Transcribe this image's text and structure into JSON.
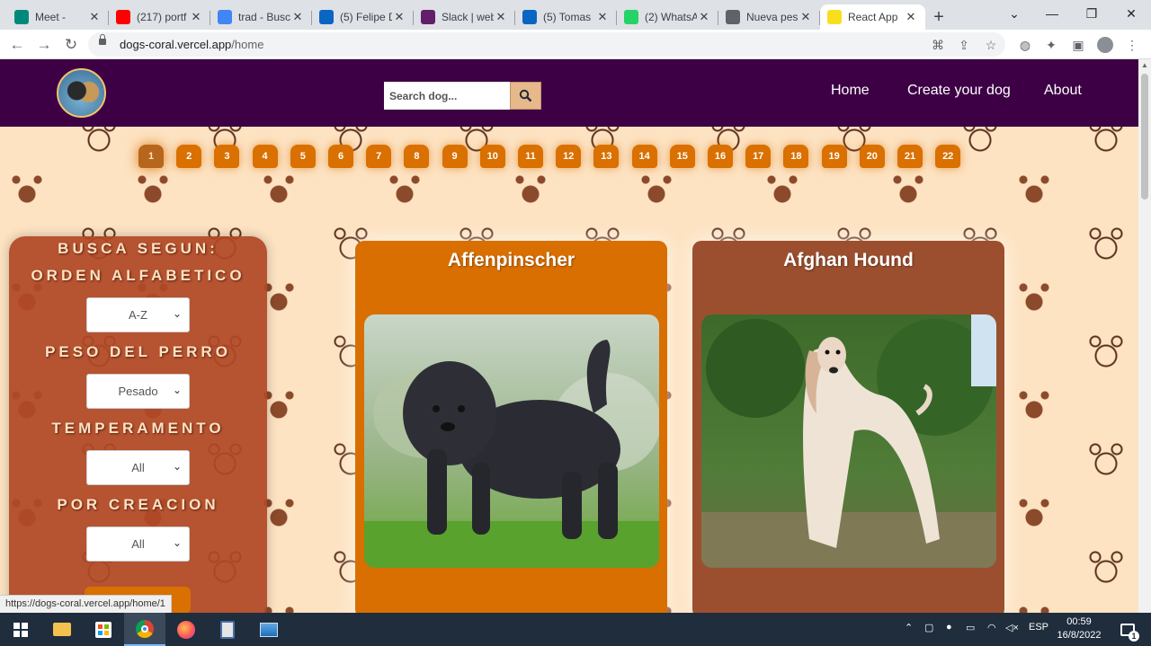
{
  "browser": {
    "tabs": [
      {
        "title": "Meet -",
        "favicon": "meet-icon",
        "color": "#00897b"
      },
      {
        "title": "(217) portf",
        "favicon": "youtube-icon",
        "color": "#ff0000"
      },
      {
        "title": "trad - Busc",
        "favicon": "google-icon",
        "color": "#4285f4"
      },
      {
        "title": "(5) Felipe D",
        "favicon": "linkedin-icon",
        "color": "#0a66c2"
      },
      {
        "title": "Slack | web",
        "favicon": "slack-icon",
        "color": "#611f69"
      },
      {
        "title": "(5) Tomas",
        "favicon": "linkedin-icon",
        "color": "#0a66c2"
      },
      {
        "title": "(2) WhatsA",
        "favicon": "whatsapp-icon",
        "color": "#25d366"
      },
      {
        "title": "Nueva pes",
        "favicon": "chrome-icon",
        "color": "#5f6368"
      },
      {
        "title": "React App",
        "favicon": "react-app-icon",
        "color": "#f7df1e",
        "active": true
      }
    ],
    "url_host": "dogs-coral.vercel.app",
    "url_path": "/home",
    "status_url": "https://dogs-coral.vercel.app/home/1"
  },
  "header": {
    "search_placeholder": "Search dog...",
    "nav": [
      "Home",
      "Create your dog",
      "About"
    ]
  },
  "pagination": {
    "pages": [
      "1",
      "2",
      "3",
      "4",
      "5",
      "6",
      "7",
      "8",
      "9",
      "10",
      "11",
      "12",
      "13",
      "14",
      "15",
      "16",
      "17",
      "18",
      "19",
      "20",
      "21",
      "22"
    ],
    "current": "1"
  },
  "filters": {
    "title_line1": "BUSCA SEGUN:",
    "title_line2": "ORDEN ALFABETICO",
    "order_value": "A-Z",
    "weight_label": "PESO DEL PERRO",
    "weight_value": "Pesado",
    "temperament_label": "TEMPERAMENTO",
    "temperament_value": "All",
    "creation_label": "POR CREACION",
    "creation_value": "All"
  },
  "cards": [
    {
      "name": "Affenpinscher"
    },
    {
      "name": "Afghan Hound"
    }
  ],
  "taskbar": {
    "lang": "ESP",
    "time": "00:59",
    "date": "16/8/2022",
    "notifications": "1"
  }
}
